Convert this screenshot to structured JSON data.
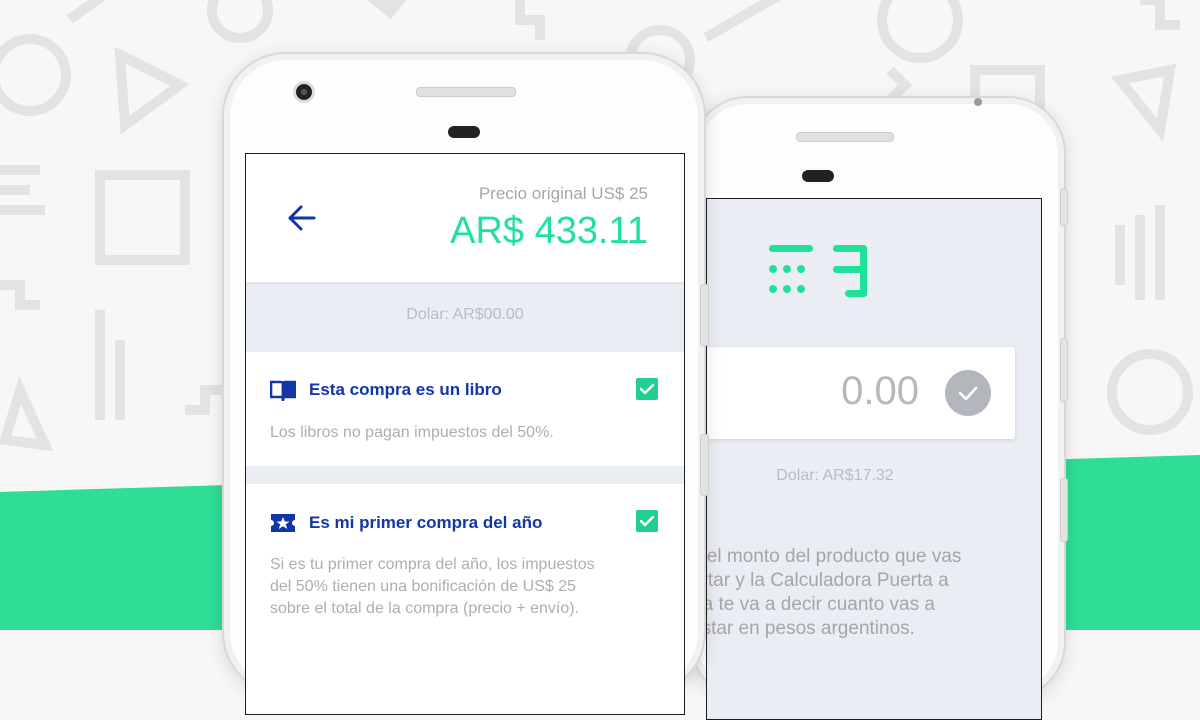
{
  "colors": {
    "accent_green": "#1fe19a",
    "band_green": "#2ede94",
    "brand_blue": "#1136a8",
    "muted_text": "#aeaeae",
    "screen_bg": "#eaedf4"
  },
  "front_screen": {
    "back_icon": "arrow-left-icon",
    "original_price": "Precio original US$ 25",
    "converted_price": "AR$ 433.11",
    "dolar_rate": "Dolar: AR$00.00",
    "options": [
      {
        "icon": "open-book-icon",
        "title": "Esta compra es un libro",
        "description": "Los libros no pagan impuestos del 50%.",
        "checked": true
      },
      {
        "icon": "ticket-star-icon",
        "title": "Es mi primer compra del año",
        "description_lines": [
          "Si es tu primer compra del año, los impuestos",
          "del 50% tienen una bonificación de US$ 25",
          "sobre el total de la compra (precio + envío)."
        ],
        "checked": true
      }
    ]
  },
  "back_screen": {
    "logo_icon": "calculadora-puerta-logo-icon",
    "amount_value": "0.00",
    "confirm_icon": "check-icon",
    "dolar_rate": "Dolar: AR$17.32",
    "instruction_lines": [
      "a el monto del producto que vas",
      "ortar y la Calculadora Puerta a",
      "rta te va a decir cuanto vas a",
      "astar en pesos argentinos."
    ]
  }
}
